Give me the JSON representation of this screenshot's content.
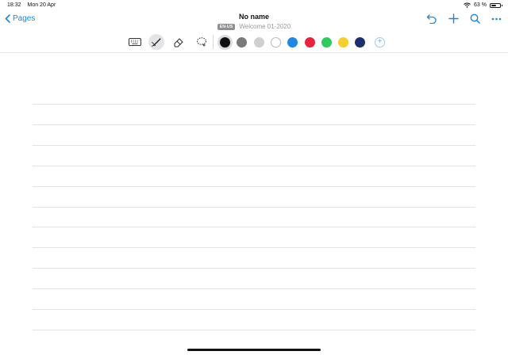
{
  "status_bar": {
    "time": "18:32",
    "date": "Mon 20 Apr",
    "battery_percent": "63 %",
    "battery_level": 0.63
  },
  "nav": {
    "back_label": "Pages",
    "title": "No name",
    "language_badge": "EN-US",
    "subtitle": "Welcome 01-2020"
  },
  "toolbar": {
    "tools": [
      "keyboard-icon",
      "pen-icon",
      "eraser-icon",
      "lasso-icon"
    ],
    "active_tool": "pen-icon",
    "colors": [
      "#111111",
      "#7a7a7a",
      "#cfcfcf",
      "#ffffff",
      "#1e88e5",
      "#e8243c",
      "#2ecc5e",
      "#f5cf2b",
      "#1f2f6e"
    ],
    "selected_color": "#111111",
    "add_color_icon": "plus-icon"
  },
  "accent_color": "#1a84e0"
}
